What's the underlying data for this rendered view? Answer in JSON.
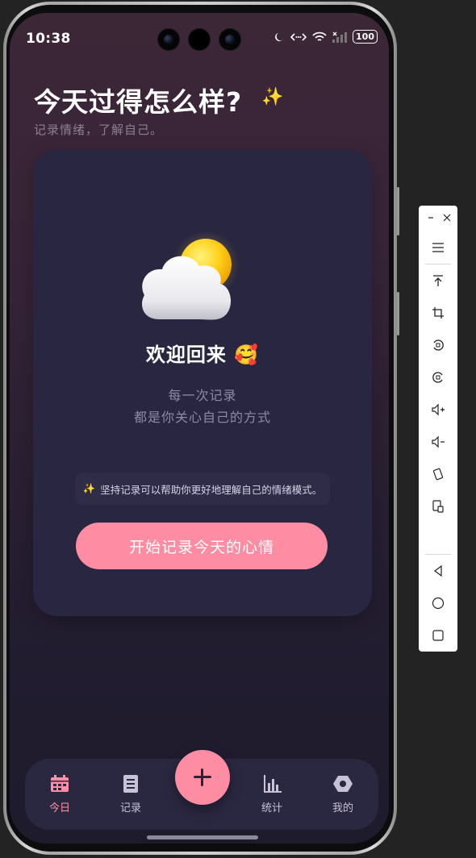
{
  "status_bar": {
    "time": "10:38",
    "battery": "100"
  },
  "header": {
    "title": "今天过得怎么样?",
    "sparkle": "✨",
    "subtitle": "记录情绪，了解自己。"
  },
  "card": {
    "welcome": "欢迎回来",
    "welcome_emoji": "🥰",
    "line1": "每一次记录",
    "line2": "都是你关心自己的方式",
    "tip_icon": "✨",
    "tip": "坚持记录可以帮助你更好地理解自己的情绪模式。",
    "cta": "开始记录今天的心情"
  },
  "nav": {
    "items": [
      {
        "label": "今日",
        "icon": "calendar-icon",
        "active": true
      },
      {
        "label": "记录",
        "icon": "list-icon",
        "active": false
      },
      {
        "label": "统计",
        "icon": "chart-icon",
        "active": false
      },
      {
        "label": "我的",
        "icon": "profile-icon",
        "active": false
      }
    ],
    "fab_icon": "plus-icon"
  },
  "toolbar": {
    "icons": [
      "minimize-icon",
      "close-icon",
      "menu-icon",
      "pin-top-icon",
      "crop-icon",
      "rotate-left-icon",
      "rotate-right-icon",
      "volume-up-icon",
      "volume-down-icon",
      "shake-icon",
      "screenshot-icon",
      "back-icon",
      "home-icon",
      "recents-icon"
    ]
  },
  "colors": {
    "accent": "#fe8da3",
    "card": "#282641",
    "nav": "#2a2740"
  }
}
